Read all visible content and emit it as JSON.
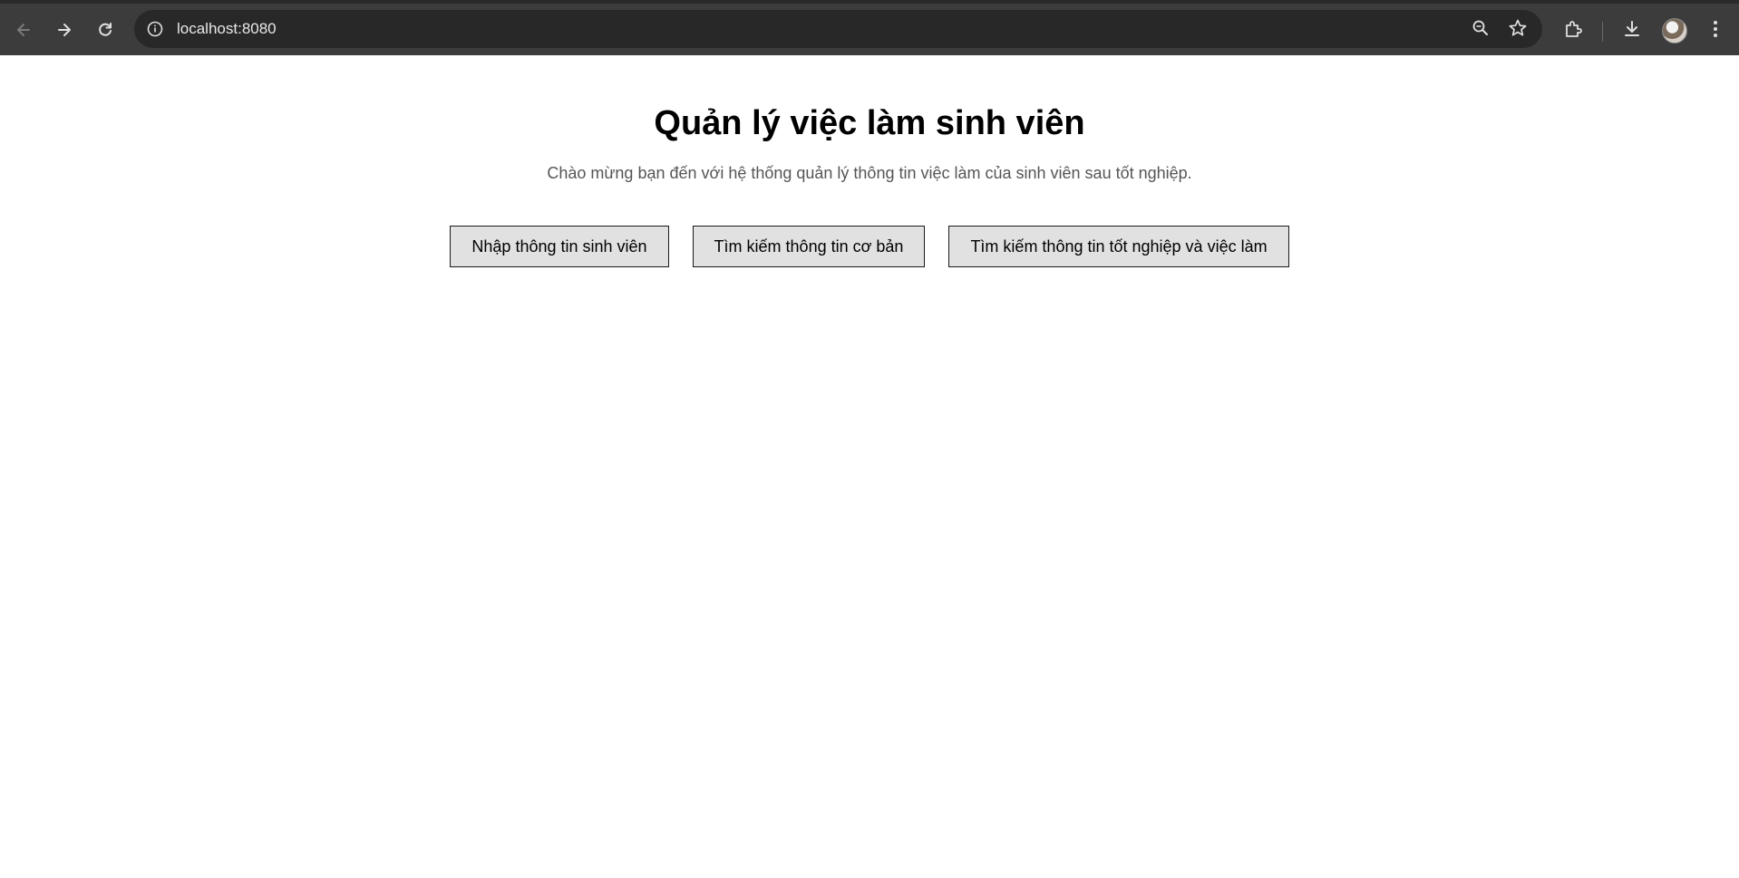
{
  "browser": {
    "url": "localhost:8080",
    "icons": [
      "back-arrow-icon",
      "forward-arrow-icon",
      "reload-icon",
      "site-info-icon",
      "zoom-icon",
      "bookmark-star-icon",
      "extensions-icon",
      "download-icon",
      "menu-dots-icon"
    ]
  },
  "page": {
    "title": "Quản lý việc làm sinh viên",
    "subtitle": "Chào mừng bạn đến với hệ thống quản lý thông tin việc làm của sinh viên sau tốt nghiệp.",
    "buttons": {
      "enter_student": "Nhập thông tin sinh viên",
      "search_basic": "Tìm kiếm thông tin cơ bản",
      "search_graduation_job": "Tìm kiếm thông tin tốt nghiệp và việc làm"
    }
  },
  "colors": {
    "browser_bar": "#3c3c3c",
    "omnibox": "#282828",
    "button_bg": "#e1e1e1",
    "subtitle_text": "#555555"
  }
}
